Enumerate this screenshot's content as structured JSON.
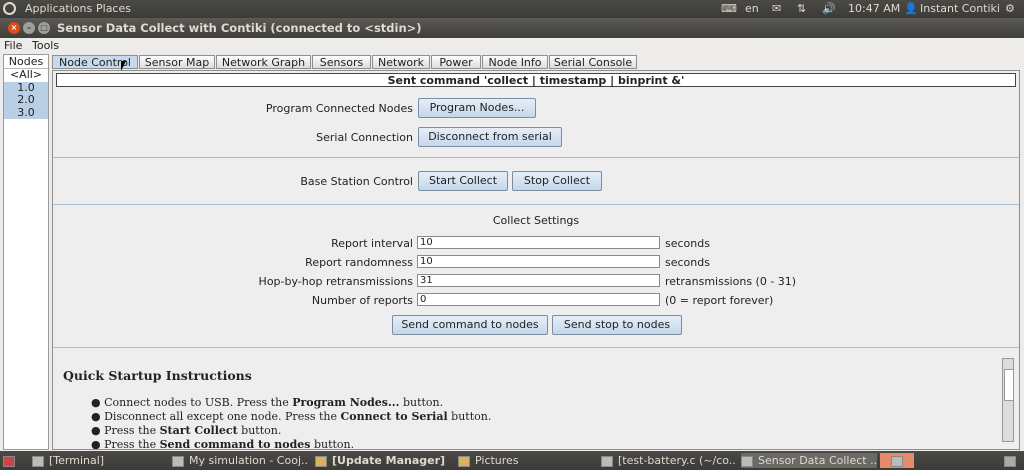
{
  "topbar": {
    "menu_applications": "Applications",
    "menu_places": "Places",
    "language": "en",
    "time": "10:47 AM",
    "user": "Instant Contiki"
  },
  "window": {
    "title": "Sensor Data Collect with Contiki (connected to <stdin>)"
  },
  "menu": {
    "file": "File",
    "tools": "Tools"
  },
  "nodes": {
    "header": "Nodes",
    "items": [
      "<All>",
      "1.0",
      "2.0",
      "3.0"
    ]
  },
  "tabs": [
    "Node Control",
    "Sensor Map",
    "Network Graph",
    "Sensors",
    "Network",
    "Power",
    "Node Info",
    "Serial Console"
  ],
  "status": "Sent command 'collect | timestamp | binprint &'",
  "controls": {
    "program_label": "Program Connected Nodes",
    "program_button": "Program Nodes...",
    "serial_label": "Serial Connection",
    "serial_button": "Disconnect from serial",
    "base_label": "Base Station Control",
    "start_button": "Start Collect",
    "stop_button": "Stop Collect"
  },
  "collect": {
    "title": "Collect Settings",
    "report_interval_label": "Report interval",
    "report_interval_value": "10",
    "report_interval_unit": "seconds",
    "randomness_label": "Report randomness",
    "randomness_value": "10",
    "randomness_unit": "seconds",
    "hop_label": "Hop-by-hop retransmissions",
    "hop_value": "31",
    "hop_unit": "retransmissions (0 - 31)",
    "num_label": "Number of reports",
    "num_value": "0",
    "num_unit": "(0 = report forever)",
    "send_button": "Send command to nodes",
    "stop_button": "Send stop to nodes"
  },
  "quickstart": {
    "title": "Quick Startup Instructions",
    "b1_pre": "Connect nodes to USB. Press the ",
    "b1_bold": "Program Nodes...",
    "b1_post": " button.",
    "b2_pre": "Disconnect all except one node. Press the ",
    "b2_bold": "Connect to Serial",
    "b2_post": " button.",
    "b3_pre": "Press the ",
    "b3_bold": "Start Collect",
    "b3_post": " button.",
    "b4_pre": "Press the ",
    "b4_bold": "Send command to nodes",
    "b4_post": " button."
  },
  "taskbar": [
    {
      "label": "[Terminal]"
    },
    {
      "label": "My simulation - Cooj..."
    },
    {
      "label": "[Update Manager]"
    },
    {
      "label": "Pictures"
    },
    {
      "label": "[test-battery.c (~/co..."
    },
    {
      "label": "Sensor Data Collect ..."
    }
  ]
}
